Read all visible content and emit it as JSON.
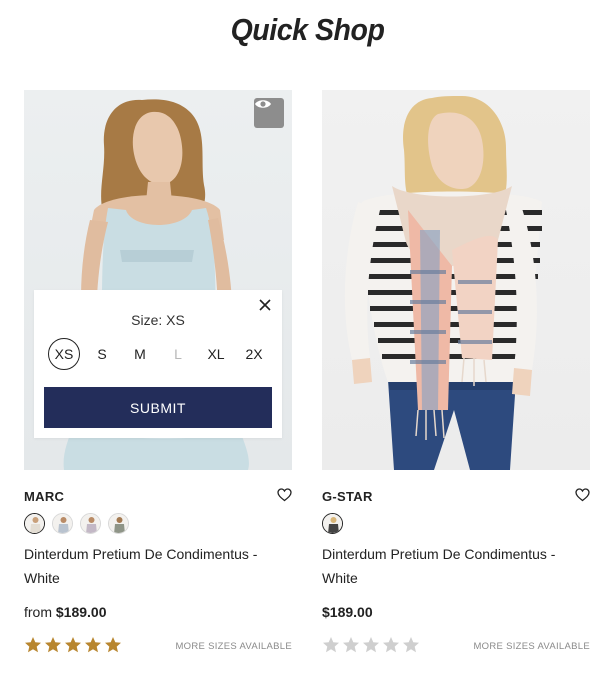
{
  "page": {
    "title": "Quick Shop"
  },
  "colors": {
    "accent": "#232d5a",
    "star_filled": "#b8862f",
    "star_empty": "#cfcfcf"
  },
  "products": [
    {
      "brand": "MARC",
      "name": "Dinterdum Pretium De Condimentus - White",
      "price_prefix": "from",
      "price": "$189.00",
      "rating": 5,
      "rating_max": 5,
      "more_sizes": "MORE SIZES AVAILABLE",
      "swatch_count": 4,
      "selected_swatch": 0,
      "quick_view_icon": "eye-icon",
      "quick_shop": {
        "size_label": "Size:",
        "selected_size": "XS",
        "sizes": [
          "XS",
          "S",
          "M",
          "L",
          "XL",
          "2X"
        ],
        "unavailable_sizes": [
          "L"
        ],
        "submit_label": "SUBMIT"
      }
    },
    {
      "brand": "G-STAR",
      "name": "Dinterdum Pretium De Condimentus - White",
      "price_prefix": "",
      "price": "$189.00",
      "rating": 0,
      "rating_max": 5,
      "more_sizes": "MORE SIZES AVAILABLE",
      "swatch_count": 1,
      "selected_swatch": 0
    }
  ]
}
